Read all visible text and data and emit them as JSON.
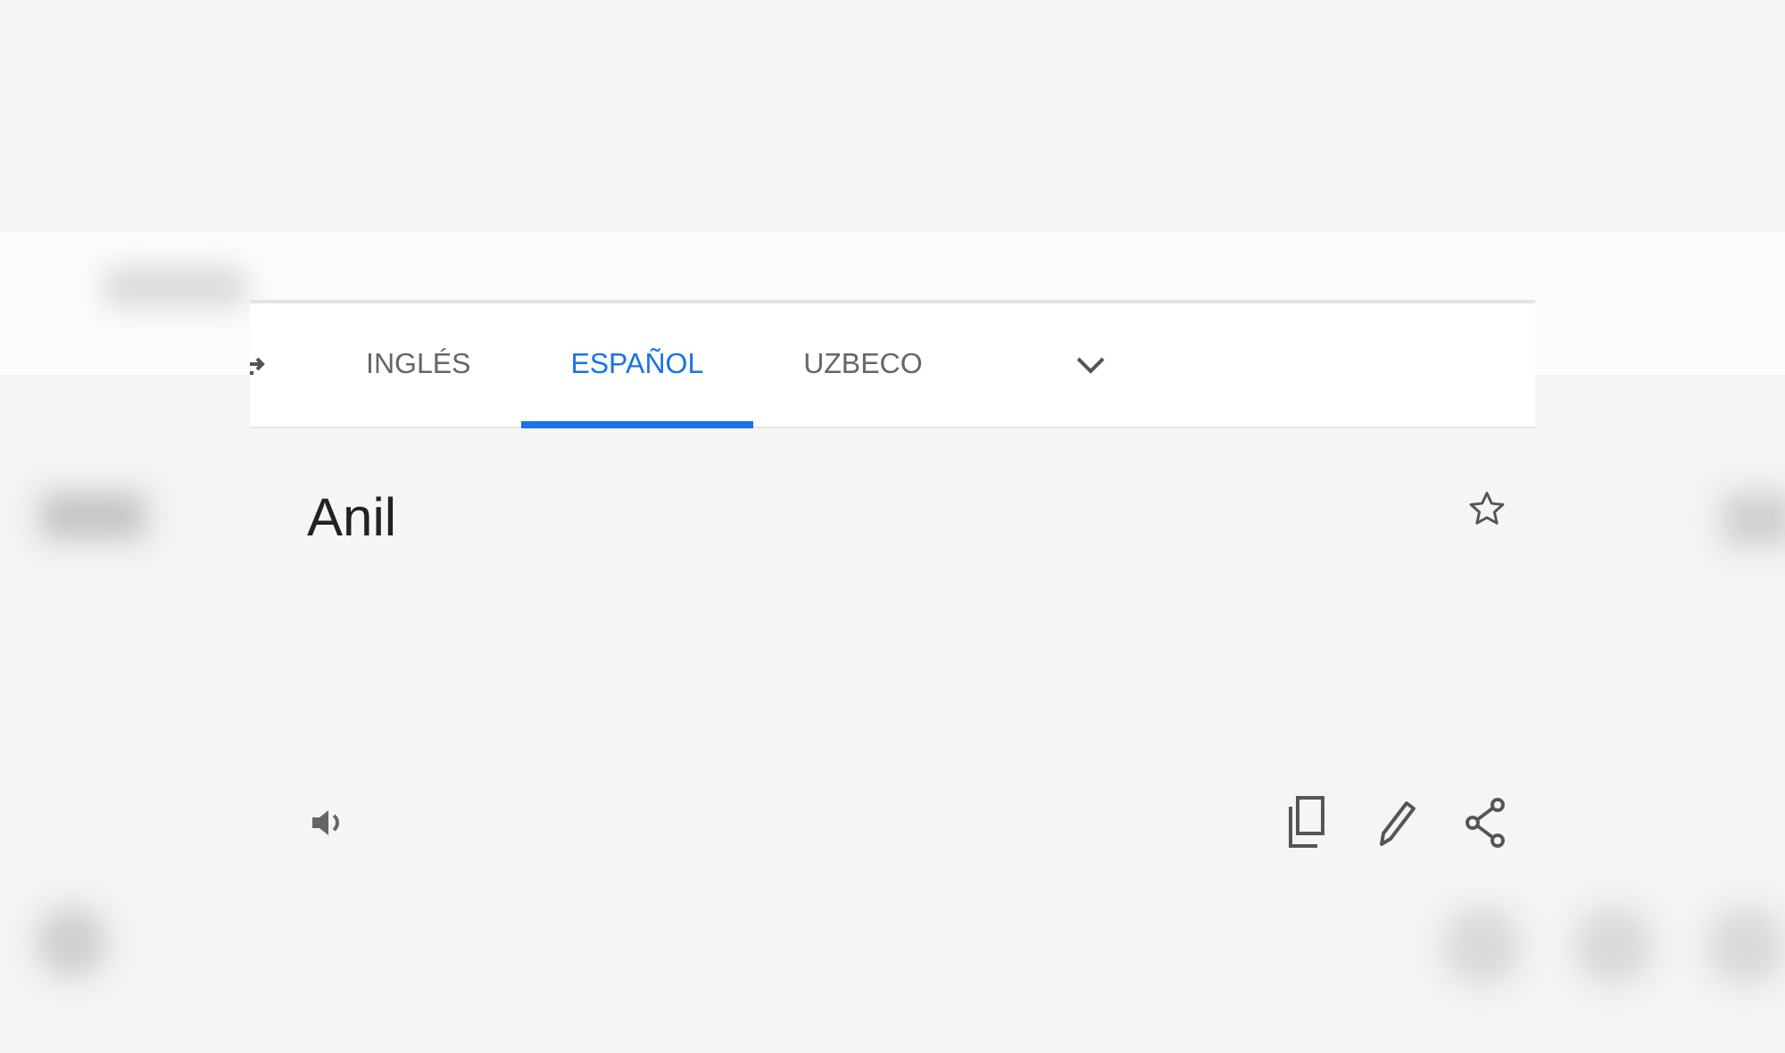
{
  "language_tabs": [
    {
      "label": "INGLÉS",
      "selected": false
    },
    {
      "label": "ESPAÑOL",
      "selected": true
    },
    {
      "label": "UZBECO",
      "selected": false
    }
  ],
  "translation": {
    "text": "Anil"
  }
}
